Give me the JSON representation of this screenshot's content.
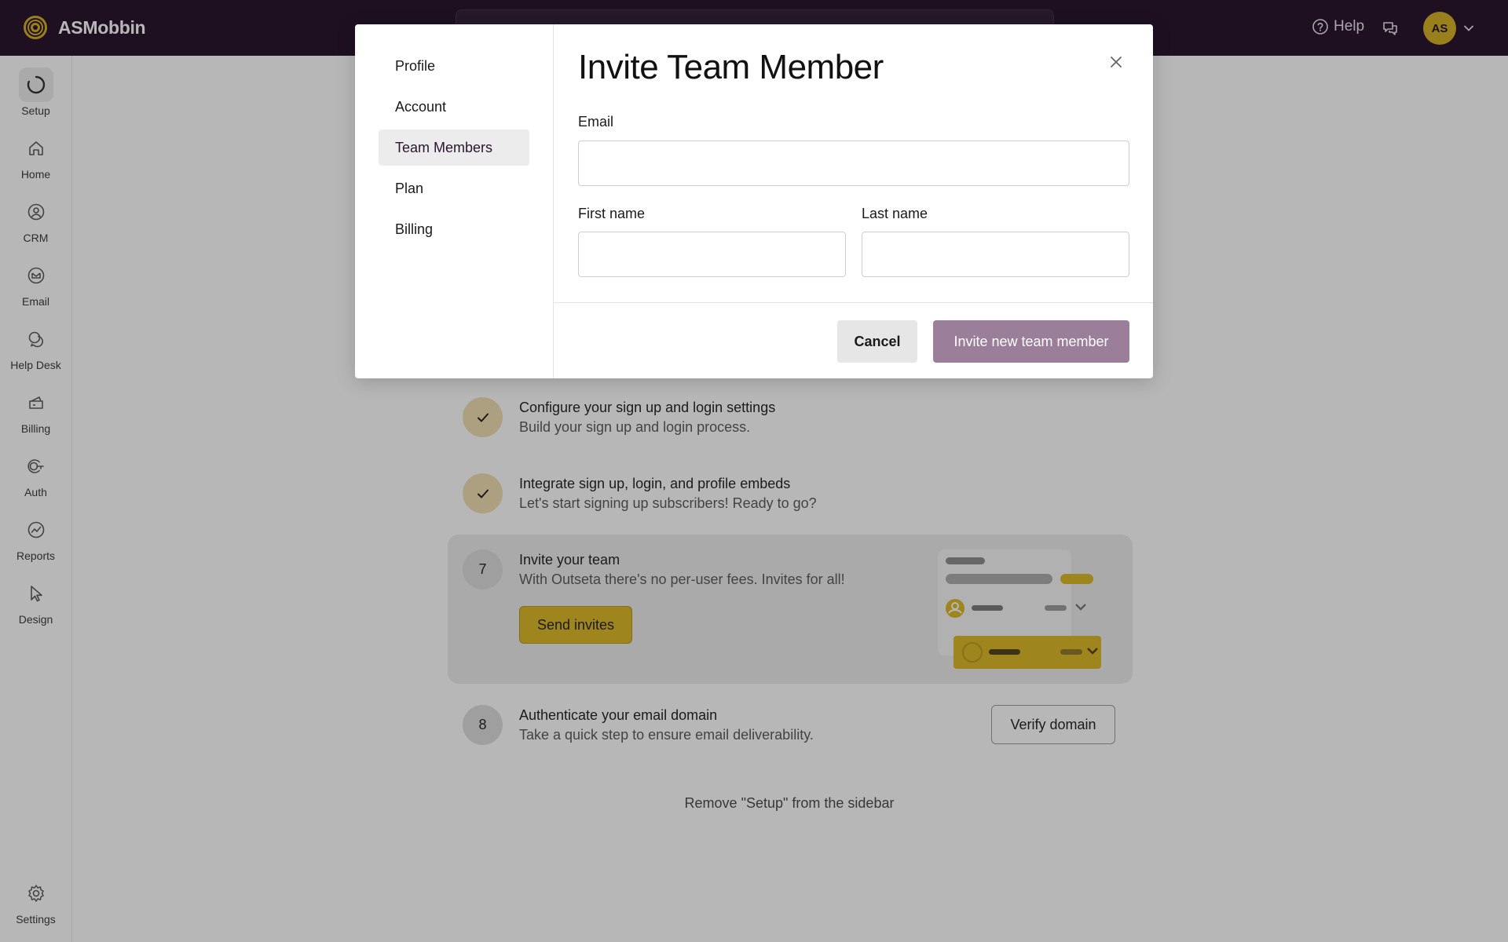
{
  "app": {
    "name": "ASMobbin",
    "brand_color": "#1e0a22",
    "accent_color": "#d4ae1c"
  },
  "topbar": {
    "help_label": "Help",
    "avatar_initials": "AS"
  },
  "sidebar": {
    "items": [
      {
        "label": "Setup",
        "icon": "setup-progress-icon"
      },
      {
        "label": "Home",
        "icon": "home-icon"
      },
      {
        "label": "CRM",
        "icon": "crm-icon"
      },
      {
        "label": "Email",
        "icon": "email-icon"
      },
      {
        "label": "Help Desk",
        "icon": "help-desk-icon"
      },
      {
        "label": "Billing",
        "icon": "billing-icon"
      },
      {
        "label": "Auth",
        "icon": "auth-icon"
      },
      {
        "label": "Reports",
        "icon": "reports-icon"
      },
      {
        "label": "Design",
        "icon": "design-icon"
      }
    ],
    "settings_label": "Settings"
  },
  "steps": [
    {
      "title": "Configure your sign up and login settings",
      "desc": "Build your sign up and login process.",
      "status": "done"
    },
    {
      "title": "Integrate sign up, login, and profile embeds",
      "desc": "Let's start signing up subscribers! Ready to go?",
      "status": "done"
    },
    {
      "number": "7",
      "title": "Invite your team",
      "desc": "With Outseta there's no per-user fees. Invites for all!",
      "button": "Send invites"
    },
    {
      "number": "8",
      "title": "Authenticate your email domain",
      "desc": "Take a quick step to ensure email deliverability.",
      "button": "Verify domain"
    }
  ],
  "remove_setup_label": "Remove \"Setup\" from the sidebar",
  "modal": {
    "nav": [
      "Profile",
      "Account",
      "Team Members",
      "Plan",
      "Billing"
    ],
    "active_nav": "Team Members",
    "title": "Invite Team Member",
    "email_label": "Email",
    "email_value": "",
    "first_name_label": "First name",
    "first_name_value": "",
    "last_name_label": "Last name",
    "last_name_value": "",
    "cancel_label": "Cancel",
    "invite_label": "Invite new team member"
  }
}
